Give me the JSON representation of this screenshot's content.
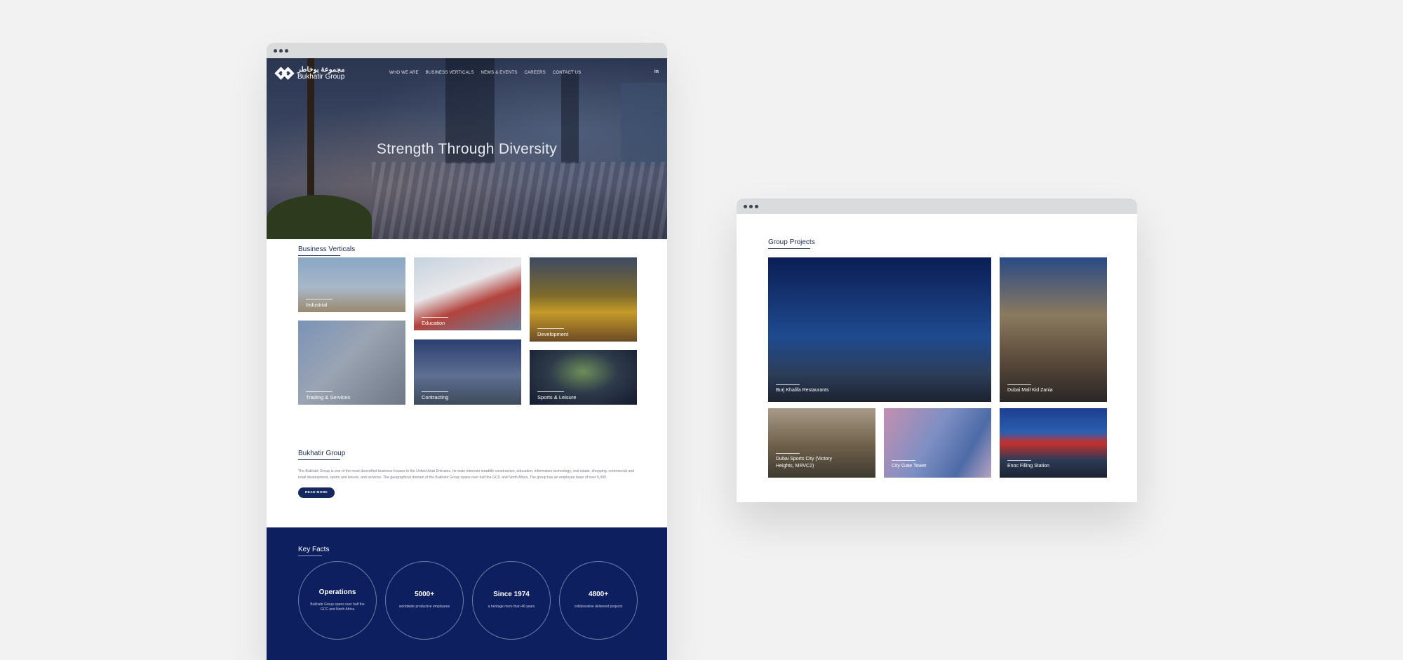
{
  "left_window": {
    "brand": {
      "arabic": "مجموعة بوخاطر",
      "english": "Bukhatir Group"
    },
    "nav": [
      "WHO WE ARE",
      "BUSINESS VERTICALS",
      "NEWS & EVENTS",
      "CAREERS",
      "CONTACT US"
    ],
    "social_icon_text": "in",
    "hero_title": "Strength Through Diversity",
    "business_verticals": {
      "heading": "Business Verticals",
      "tiles": [
        "Industrial",
        "Education",
        "Development",
        "Trading & Services",
        "Contracting",
        "Sports & Leisure"
      ]
    },
    "about": {
      "heading": "Bukhatir Group",
      "text": "The Bukhatir Group is one of the most diversified business houses in the United Arab Emirates. Its main interests straddle construction, education, information technology, real estate, shopping, commercial and retail development, sports and leisure, and services. The geographical domain of the Bukhatir Group spans over half the GCC and North Africa. The group has an employee base of over 5,000.",
      "button": "READ MORE"
    },
    "key_facts": {
      "heading": "Key Facts",
      "items": [
        {
          "title": "Operations",
          "sub": "Bukhatir Group spans over half the GCC and North Africa"
        },
        {
          "title": "5000+",
          "sub": "worldwide productive employees"
        },
        {
          "title": "Since 1974",
          "sub": "a heritage more than 46 years"
        },
        {
          "title": "4800+",
          "sub": "collaborative delivered projects"
        }
      ]
    }
  },
  "right_window": {
    "heading": "Group Projects",
    "projects": [
      "Burj Khalifa Restaurants",
      "Dubai Mall Kid Zania",
      "Dubai Sports City (Victory Heights, MRVC2)",
      "City Gate Tower",
      "Enoc Filling Station"
    ]
  },
  "colors": {
    "navy": "#0d1f5f",
    "background": "#f2f2f2",
    "window_bar": "#d9dbdd"
  }
}
